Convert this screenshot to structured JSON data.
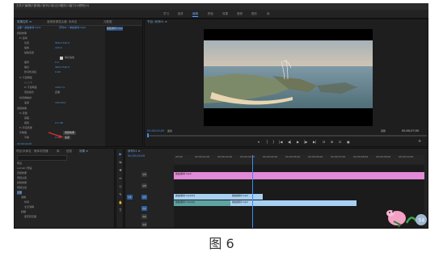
{
  "menubar": {
    "items": [
      "文件(F)",
      "编辑(E)",
      "剪辑(C)",
      "序列(S)",
      "标记(M)",
      "图形(G)",
      "窗口(W)",
      "帮助(H)"
    ]
  },
  "workspaces": {
    "items": [
      "学习",
      "组件",
      "编辑",
      "颜色",
      "效果",
      "音频",
      "图形",
      "库"
    ],
    "active_index": 2
  },
  "effect_controls": {
    "tab_label": "效果控件 ≡",
    "tab2_label": "音频剪辑混合器: 未命名",
    "tab3_label": "元数据",
    "source_label": "主要 * 航拍素材.mp4",
    "sequence_label": "序列01 * 航拍素材.mp4",
    "clip_name": "航拍素材.mp4",
    "section_video": "视频效果",
    "motion": "fx 运动",
    "position": "位置",
    "position_value": "960.0    540.0",
    "scale": "缩放",
    "scale_value": "100.0",
    "scale_width": "缩放宽度",
    "uniform_scale": "等比缩放",
    "rotation": "旋转",
    "rotation_value": "0.0",
    "anchor": "锚点",
    "anchor_value": "960.0    540.0",
    "flicker": "防闪烁滤镜",
    "flicker_value": "0.00",
    "opacity": "fx 不透明度",
    "opacity_value": "100.0 %",
    "blend": "混合模式",
    "blend_value": "正常",
    "time_remap": "时间重映射",
    "speed": "速度",
    "speed_value": "100.00%",
    "section_audio": "音频效果",
    "volume": "fx 音量",
    "bypass": "旁路",
    "level": "级别",
    "level_value": "0.0 dB",
    "channel_volume": "fx 声道音量",
    "panner": "声像器",
    "balance": "平衡",
    "balance_value": "0.0",
    "dropdown_selected": "视频效果",
    "dropdown_options": [
      "速度"
    ],
    "timecode": "00;00;04;00"
  },
  "program_monitor": {
    "title": "节目: 序列01 ≡",
    "timecode_left": "00;00;04;00",
    "fit": "适合",
    "full": "完整",
    "timecode_right": "00;00;07;00",
    "buttons": [
      "▾",
      "{",
      "}",
      "|◀",
      "◀|",
      "▶",
      "|▶",
      "▶|",
      "⊟",
      "⊞",
      "⊡",
      "▣"
    ]
  },
  "project_panel": {
    "tabs": [
      "项目:未命名",
      "媒体浏览器",
      "库",
      "信息",
      "效果 ≡"
    ],
    "search_placeholder": "",
    "items": [
      "预设",
      "Lumetri 预设",
      "音频效果",
      "音频过渡",
      "视频效果",
      "视频过渡",
      "过渡",
      "溶解",
      "时间",
      "交叉溶解",
      "模糊",
      "变形稳定器"
    ]
  },
  "tools": {
    "items": [
      "▶",
      "⇆",
      "✥",
      "↔",
      "◇",
      "✎",
      "✋",
      "T"
    ]
  },
  "timeline": {
    "title": "序列01 ≡",
    "timecode": "00;00;04;00",
    "ruler": [
      "00;00",
      "00;00;01;00",
      "00;00;02;00",
      "00;00;03;00",
      "00;00;04;00",
      "00;00;05;00",
      "00;00;06;00",
      "00;00;07;00",
      "00;00;08;00",
      "00;00;09;00",
      "00;00;10;00"
    ],
    "tracks": [
      {
        "name": "V3",
        "toggle": "V1"
      },
      {
        "name": "V2"
      },
      {
        "name": "V1"
      },
      {
        "name": "A1"
      },
      {
        "name": "A2"
      },
      {
        "name": "A3"
      }
    ],
    "clips": {
      "pink": "航拍素材.mp4",
      "v1a": "航拍素材.mp4[V]",
      "v1b": "航拍素材.mp4",
      "a1a": "航拍素材.mp4[A]",
      "a1b": "航拍素材.mp4"
    },
    "colors": {
      "pink": "#e18ad8",
      "blue": "#a7d0f2",
      "teal": "#5fa3a3",
      "playhead": "#3b8cf2"
    }
  },
  "caption": "图 6"
}
